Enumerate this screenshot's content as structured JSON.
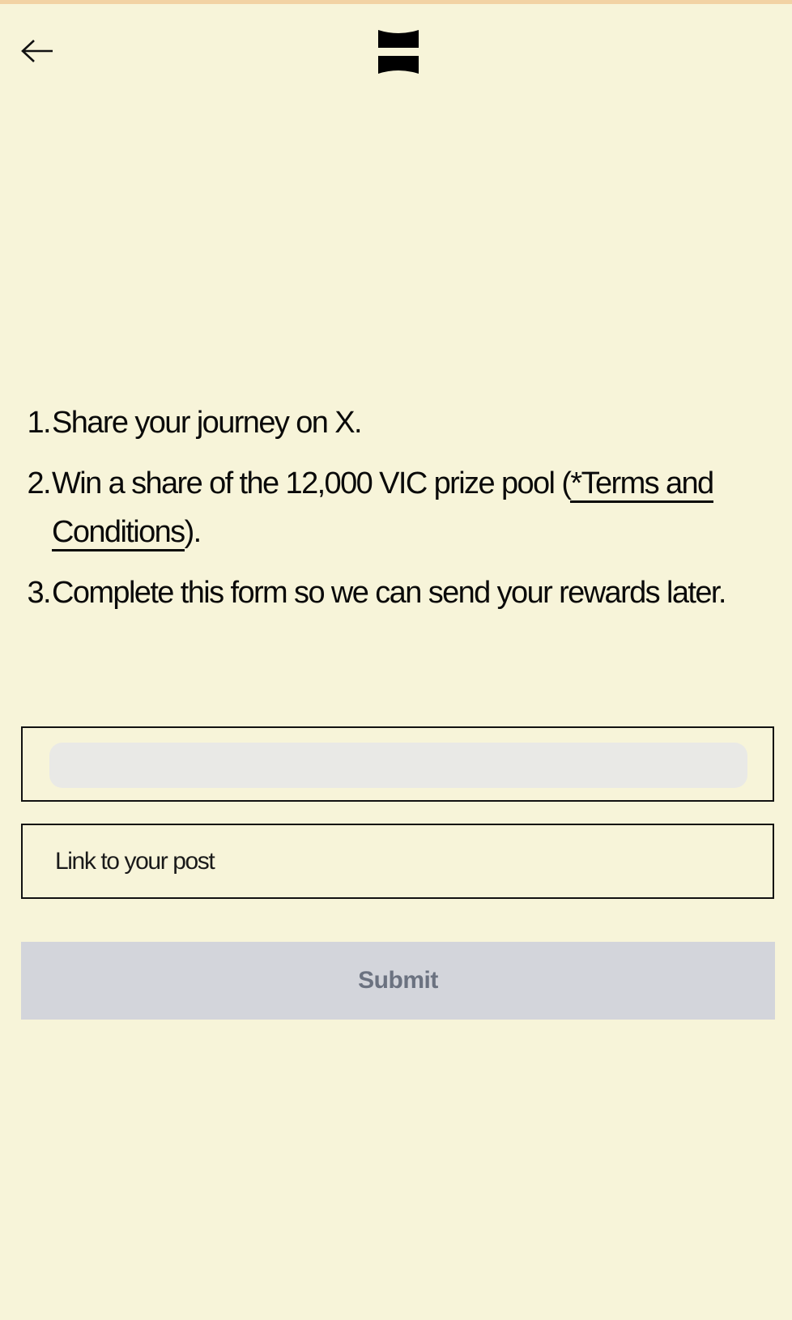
{
  "header": {
    "back_icon": "arrow-left-icon",
    "logo_icon": "brand-logo-icon"
  },
  "steps": [
    {
      "number": "1.",
      "text": "Share your journey on X."
    },
    {
      "number": "2.",
      "text_before": "Win a share of the 12,000 VIC prize pool (",
      "link_label": "*Terms and Conditions",
      "text_after": ")."
    },
    {
      "number": "3.",
      "text": "Complete this form so we can send your rewards later."
    }
  ],
  "form": {
    "post_link_placeholder": "Link to your post",
    "post_link_value": "",
    "submit_label": "Submit"
  },
  "colors": {
    "background": "#f7f4d9",
    "top_strip": "#f2d2a4",
    "submit_disabled_bg": "#d3d5db",
    "submit_disabled_text": "#6b7280"
  }
}
